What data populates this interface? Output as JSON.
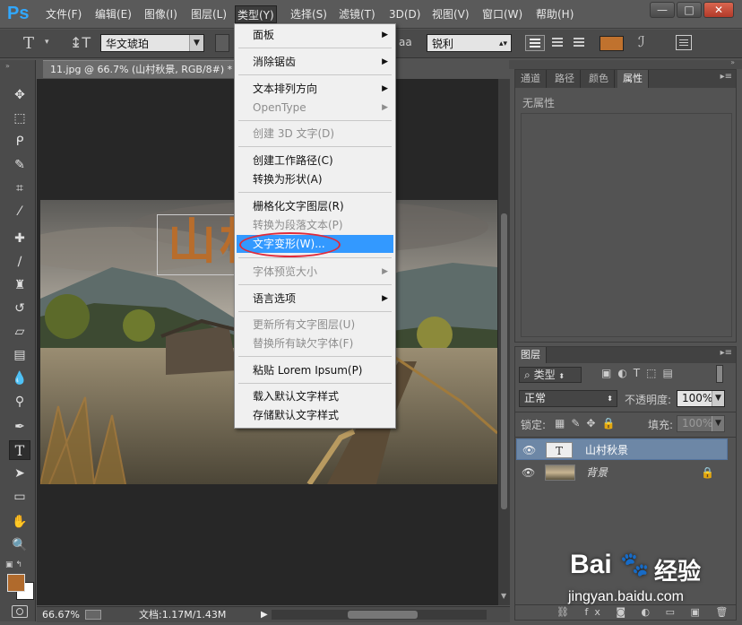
{
  "menubar": {
    "logo": "Ps",
    "items": [
      "文件(F)",
      "编辑(E)",
      "图像(I)",
      "图层(L)",
      "类型(Y)",
      "选择(S)",
      "滤镜(T)",
      "3D(D)",
      "视图(V)",
      "窗口(W)",
      "帮助(H)"
    ],
    "active": "类型(Y)"
  },
  "window": {
    "minimize": "—",
    "restore": "□",
    "close": "✕"
  },
  "options": {
    "font_family": "华文琥珀",
    "aa_label": "aa",
    "aa_value": "锐利",
    "text_color": "#c0722e"
  },
  "document": {
    "tab_title": "11.jpg @ 66.7% (山村秋景, RGB/8#) *",
    "text_layer_chars": "山村",
    "zoom": "66.67%",
    "doc_info": "文档:1.17M/1.43M"
  },
  "props_panel": {
    "tabs": [
      "通道",
      "路径",
      "颜色",
      "属性"
    ],
    "active_tab": "属性",
    "content": "无属性"
  },
  "layers_panel": {
    "tab": "图层",
    "filter_kind": "类型",
    "blend_mode": "正常",
    "opacity_label": "不透明度:",
    "opacity_value": "100%",
    "lock_label": "锁定:",
    "fill_label": "填充:",
    "fill_value": "100%",
    "layers": [
      {
        "name": "山村秋景",
        "type": "text",
        "selected": true
      },
      {
        "name": "背景",
        "type": "image",
        "selected": false,
        "locked": true
      }
    ]
  },
  "type_menu": {
    "items": [
      {
        "label": "面板",
        "submenu": true,
        "disabled": false
      },
      {
        "sep": true
      },
      {
        "label": "消除锯齿",
        "submenu": true,
        "disabled": false
      },
      {
        "sep": true
      },
      {
        "label": "文本排列方向",
        "submenu": true,
        "disabled": false
      },
      {
        "label": "OpenType",
        "submenu": true,
        "disabled": true
      },
      {
        "sep": true
      },
      {
        "label": "创建 3D 文字(D)",
        "disabled": true
      },
      {
        "sep": true
      },
      {
        "label": "创建工作路径(C)",
        "disabled": false
      },
      {
        "label": "转换为形状(A)",
        "disabled": false
      },
      {
        "sep": true
      },
      {
        "label": "栅格化文字图层(R)",
        "disabled": false
      },
      {
        "label": "转换为段落文本(P)",
        "disabled": true
      },
      {
        "label": "文字变形(W)...",
        "disabled": false,
        "highlighted": true
      },
      {
        "sep": true
      },
      {
        "label": "字体预览大小",
        "submenu": true,
        "disabled": true
      },
      {
        "sep": true
      },
      {
        "label": "语言选项",
        "submenu": true,
        "disabled": false
      },
      {
        "sep": true
      },
      {
        "label": "更新所有文字图层(U)",
        "disabled": true
      },
      {
        "label": "替换所有缺欠字体(F)",
        "disabled": true
      },
      {
        "sep": true
      },
      {
        "label": "粘贴 Lorem Ipsum(P)",
        "disabled": false
      },
      {
        "sep": true
      },
      {
        "label": "载入默认文字样式",
        "disabled": false
      },
      {
        "label": "存储默认文字样式",
        "disabled": false
      }
    ]
  },
  "watermark": {
    "brand": "Bai",
    "paw": "🐾",
    "brand2": "经验",
    "url": "jingyan.baidu.com"
  },
  "colors": {
    "foreground": "#b06a2c",
    "background": "#ffffff",
    "highlight": "#3399ff",
    "annotation": "#e02a3a"
  }
}
